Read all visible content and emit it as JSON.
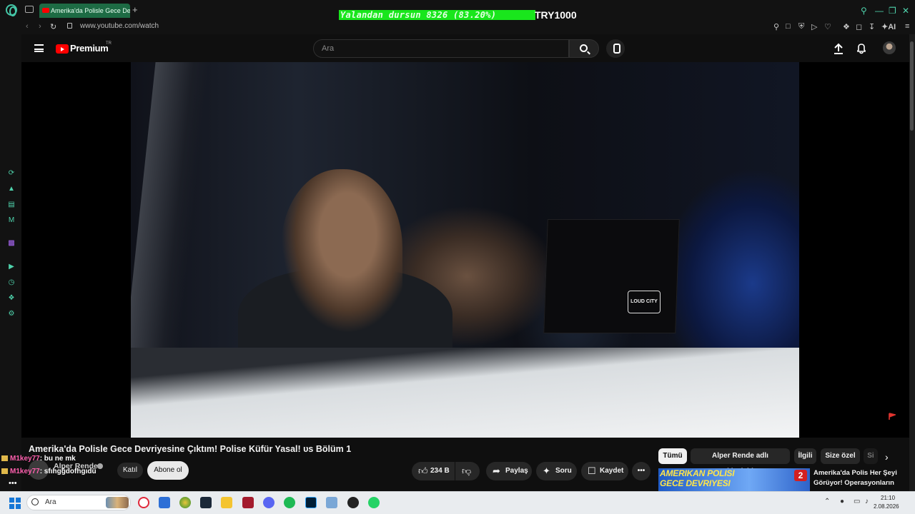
{
  "browser": {
    "tab_title": "Amerika'da Polisle Gece De",
    "new_tab": "+",
    "url": "www.youtube.com/watch",
    "overlay_stat": "Yalandan dursun 8326 (83.20%)",
    "overlay_currency": "TRY1000",
    "ai_label": "AI"
  },
  "youtube": {
    "brand": "Premium",
    "region": "TR",
    "search_placeholder": "Ara"
  },
  "video": {
    "sticker_text": "LOUD CITY",
    "title": "Amerika'da Polisle Gece Devriyesine Çıktım! Polise Küfür Yasal! ᴜs Bölüm 1",
    "channel": "Alper Rende",
    "join_label": "Katıl",
    "subscribe_label": "Abone ol",
    "likes": "234 B",
    "share_label": "Paylaş",
    "ask_label": "Soru",
    "save_label": "Kaydet",
    "more_label": "•••"
  },
  "chat": [
    {
      "nick": "M1key77",
      "message": ": bu ne mk"
    },
    {
      "nick": "M1key77",
      "message": ": sfıhgğdofhgıdü"
    }
  ],
  "chat_more": "•••",
  "recommendations": {
    "chips": [
      "Tümü",
      "Alper Rende adlı yükleyiciden",
      "İlgili",
      "Size özel",
      "Si"
    ],
    "first": {
      "thumb_text_line1": "AMERIKAN POLISI",
      "thumb_text_line2": "GECE DEVRIYESI",
      "thumb_badge": "2",
      "title": "Amerika'da Polis Her Şeyi Görüyor! Operasyonların"
    }
  },
  "taskbar": {
    "search_placeholder": "Ara",
    "time": "21:10",
    "date": "2.08.2026"
  },
  "colors": {
    "accent_green": "#19e61c",
    "youtube_red": "#ff0000",
    "opera_teal": "#45c7a8",
    "chat_nick": "#ff5fae"
  }
}
